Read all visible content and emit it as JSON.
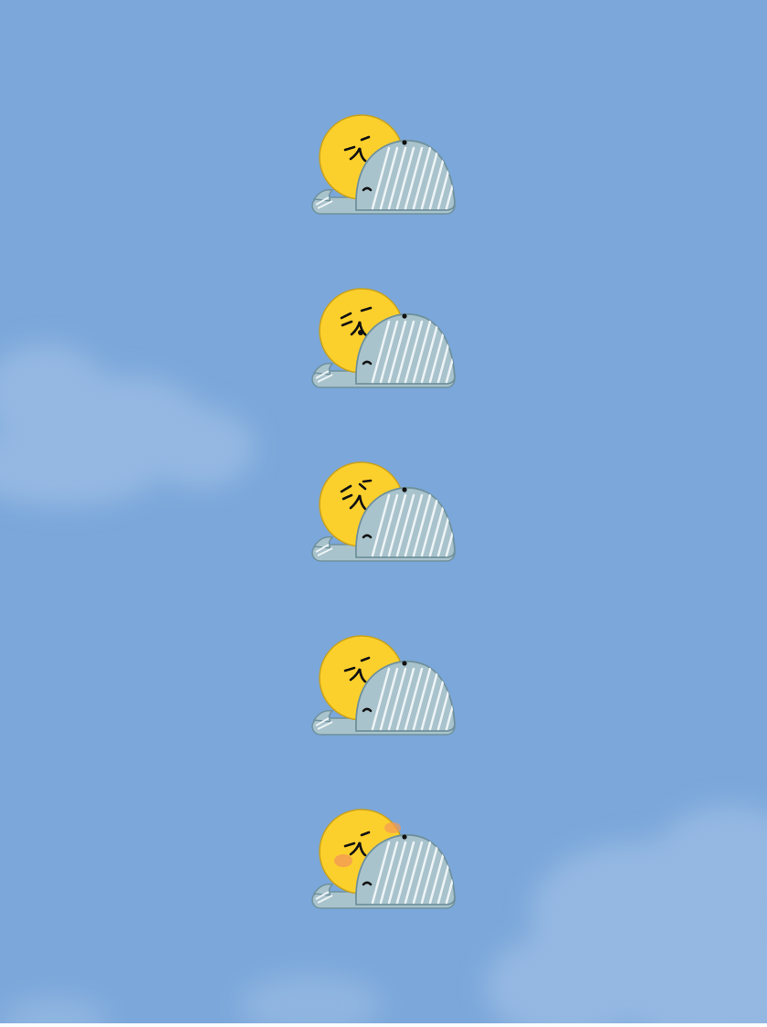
{
  "scene": {
    "sky_color": "#7ba7da",
    "cloud_color": "#a9c6e8",
    "sun_color": "#fcd02c",
    "sun_outline_color": "#c9a11a",
    "blanket_color": "#a9c3cd",
    "blanket_stripe_color": "#eef4f6",
    "blanket_outline_color": "#6f919c",
    "blush_color": "#f39a55",
    "sleeping_suns": [
      {
        "expression": "content-sleep"
      },
      {
        "expression": "drooling-sleep"
      },
      {
        "expression": "troubled-sleep"
      },
      {
        "expression": "content-sleep"
      },
      {
        "expression": "blushing-sleep"
      }
    ]
  }
}
